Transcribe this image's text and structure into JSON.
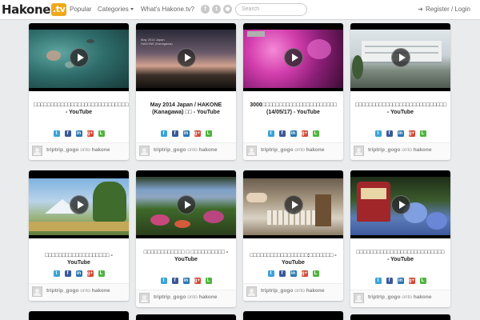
{
  "header": {
    "logo_text": "Hakone",
    "logo_badge": ".tv",
    "nav": {
      "popular": "Popular",
      "categories": "Categories",
      "about": "What's Hakone.tv?"
    },
    "social_icons": [
      "facebook-icon",
      "twitter-icon",
      "rss-icon"
    ],
    "search_placeholder": "Search",
    "login_label": "Register / Login"
  },
  "pin_footer": {
    "user": "triptrip_gogo",
    "onto_word": "onto",
    "board": "hakone"
  },
  "share_icons": [
    "twitter-icon",
    "facebook-icon",
    "linkedin-icon",
    "google-plus-icon",
    "line-icon"
  ],
  "colors": {
    "logo_badge": "#f0a81c",
    "background": "#e9ebec",
    "twitter": "#3aa3d8",
    "facebook": "#3b5998",
    "linkedin": "#2a77b3",
    "google_plus": "#d34836",
    "line": "#4db53c"
  },
  "cards": [
    {
      "title": "□□□□□□□□□□□□□□□□□□□□□□□□□□□□ - YouTube",
      "thumb": "aquarium"
    },
    {
      "title": "May 2014 Japan / HAKONE (Kanagawa) □□ - YouTube",
      "thumb": "sunset"
    },
    {
      "title": "3000□□□□□□□□□□□□□□□□□□□□□□ (14/05/17) - YouTube",
      "thumb": "azalea"
    },
    {
      "title": "□□□□□□□□□□□□□□□□□□□□□□□□□□□ - YouTube",
      "thumb": "hotel"
    },
    {
      "title": "□□□□□□□□□□□□□□□□□□□ - YouTube",
      "thumb": "fuji"
    },
    {
      "title": "□□□□□□□□□□□□ □ □□□□□□□□□□ - YouTube",
      "thumb": "garden"
    },
    {
      "title": "□□□□□□□□□□□□□□□□□:□□□□□□□ - YouTube",
      "thumb": "puzzle"
    },
    {
      "title": "□□□□□□□□□□□□□□□□□□□□□□□□□□ - YouTube",
      "thumb": "train"
    }
  ]
}
